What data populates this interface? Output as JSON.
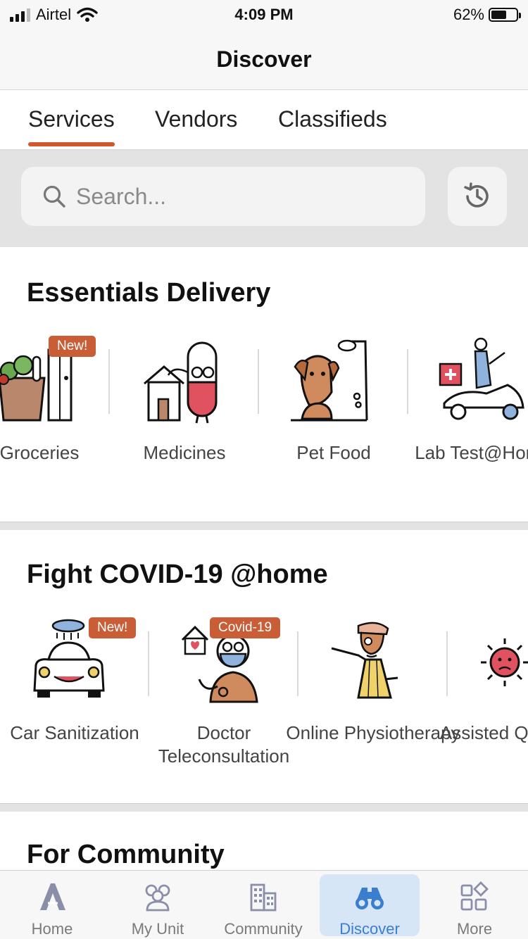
{
  "status_bar": {
    "carrier": "Airtel",
    "time": "4:09 PM",
    "battery": "62%",
    "battery_level": 0.62
  },
  "header": {
    "title": "Discover"
  },
  "tabs": [
    {
      "label": "Services",
      "active": true
    },
    {
      "label": "Vendors",
      "active": false
    },
    {
      "label": "Classifieds",
      "active": false
    }
  ],
  "search": {
    "placeholder": "Search...",
    "value": ""
  },
  "sections": {
    "essentials": {
      "title": "Essentials Delivery",
      "items": [
        {
          "label": "Groceries",
          "badge": "New!",
          "icon": "groceries-icon"
        },
        {
          "label": "Medicines",
          "icon": "medicines-icon"
        },
        {
          "label": "Pet Food",
          "icon": "pet-food-icon"
        },
        {
          "label": "Lab Test@Home",
          "icon": "lab-test-icon"
        }
      ]
    },
    "covid": {
      "title": "Fight COVID-19 @home",
      "items": [
        {
          "label": "Car Sanitization",
          "badge": "New!",
          "icon": "car-sanitization-icon"
        },
        {
          "label": "Doctor Teleconsultation",
          "badge": "Covid-19",
          "icon": "doctor-icon"
        },
        {
          "label": "Online Physiotherapy",
          "icon": "physiotherapy-icon"
        },
        {
          "label": "Assisted Quarantine",
          "icon": "virus-icon"
        }
      ]
    },
    "community": {
      "title": "For Community"
    }
  },
  "bottom_tabs": [
    {
      "label": "Home",
      "icon": "home-logo-icon",
      "active": false
    },
    {
      "label": "My Unit",
      "icon": "people-icon",
      "active": false
    },
    {
      "label": "Community",
      "icon": "building-icon",
      "active": false
    },
    {
      "label": "Discover",
      "icon": "binoculars-icon",
      "active": true
    },
    {
      "label": "More",
      "icon": "grid-icon",
      "active": false
    }
  ],
  "colors": {
    "accent": "#d2572d",
    "badge": "#c95d36",
    "active_tab": "#3b7ed0",
    "active_tab_bg": "#d6e6f7"
  }
}
